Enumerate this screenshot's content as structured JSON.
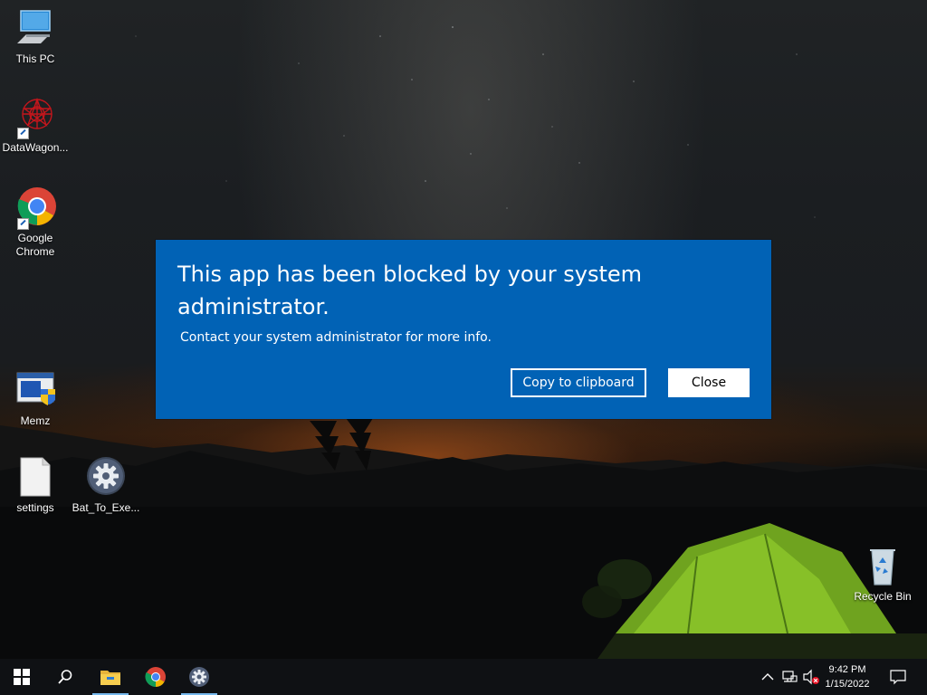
{
  "desktop": {
    "icons": [
      {
        "label": "This PC",
        "icon": "computer-icon"
      },
      {
        "label": "DataWagon...",
        "icon": "datawagon-icon"
      },
      {
        "label": "Google Chrome",
        "icon": "chrome-icon"
      },
      {
        "label": "Memz",
        "icon": "memz-icon"
      },
      {
        "label": "settings",
        "icon": "blank-file-icon"
      },
      {
        "label": "Bat_To_Exe...",
        "icon": "gear-icon"
      },
      {
        "label": "Recycle Bin",
        "icon": "recycle-bin-icon"
      }
    ]
  },
  "dialog": {
    "title": "This app has been blocked by your system administrator.",
    "body": "Contact your system administrator for more info.",
    "copy_label": "Copy to clipboard",
    "close_label": "Close",
    "background": "#0162b5"
  },
  "taskbar": {
    "items": [
      "windows-start-icon",
      "search-icon",
      "file-explorer-icon",
      "chrome-icon",
      "settings-gear-icon"
    ],
    "tray": {
      "time": "9:42 PM",
      "date": "1/15/2022",
      "icons": [
        "chevron-up-icon",
        "network-icon",
        "volume-muted-icon",
        "notification-icon"
      ]
    }
  }
}
